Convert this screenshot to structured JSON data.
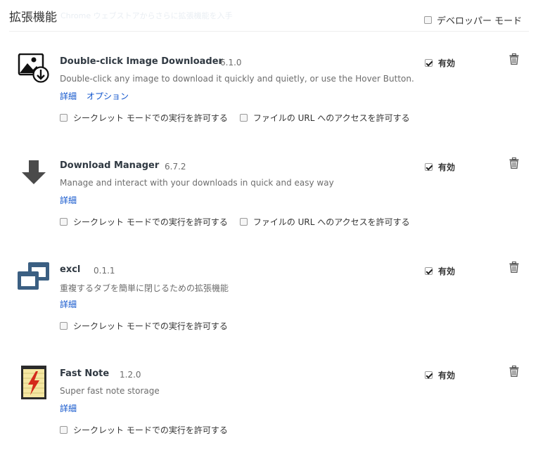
{
  "header": {
    "title": "拡張機能",
    "faded_text": "Chrome ウェブストアからさらに拡張機能を入手",
    "developer_mode_label": "デベロッパー モード",
    "developer_mode_checked": false
  },
  "extensions": [
    {
      "name": "Double-click Image Downloader",
      "version": "6.1.0",
      "description": "Double-click any image to download it quickly and quietly, or use the Hover Button.",
      "links": [
        "詳細",
        "オプション"
      ],
      "enable_label": "有効",
      "enabled": true,
      "options": [
        {
          "label": "シークレット モードでの実行を許可する",
          "checked": false
        },
        {
          "label": "ファイルの URL へのアクセスを許可する",
          "checked": false
        }
      ],
      "icon": "image-download-icon"
    },
    {
      "name": "Download Manager",
      "version": "6.7.2",
      "description": "Manage and interact with your downloads in quick and easy way",
      "links": [
        "詳細"
      ],
      "enable_label": "有効",
      "enabled": true,
      "options": [
        {
          "label": "シークレット モードでの実行を許可する",
          "checked": false
        },
        {
          "label": "ファイルの URL へのアクセスを許可する",
          "checked": false
        }
      ],
      "icon": "download-arrow-icon"
    },
    {
      "name": "excl",
      "version": "0.1.1",
      "description": "重複するタブを簡単に閉じるための拡張機能",
      "links": [
        "詳細"
      ],
      "enable_label": "有効",
      "enabled": true,
      "options": [
        {
          "label": "シークレット モードでの実行を許可する",
          "checked": false
        }
      ],
      "icon": "duplicate-windows-icon"
    },
    {
      "name": "Fast Note",
      "version": "1.2.0",
      "description": "Super fast note storage",
      "links": [
        "詳細"
      ],
      "enable_label": "有効",
      "enabled": true,
      "options": [
        {
          "label": "シークレット モードでの実行を許可する",
          "checked": false
        }
      ],
      "icon": "lightning-note-icon"
    }
  ],
  "colors": {
    "link": "#1155cc",
    "excl_icon": "#3b5f82",
    "fast_note_bolt": "#d42a1c",
    "fast_note_paper": "#f5e7a2"
  }
}
